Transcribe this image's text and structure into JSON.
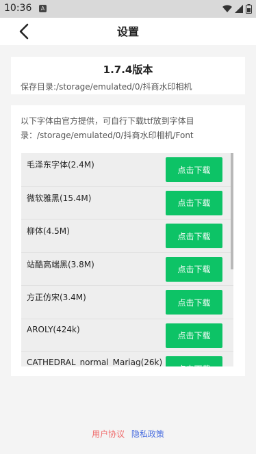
{
  "status": {
    "time": "10:36",
    "notif_label": "A"
  },
  "header": {
    "title": "设置"
  },
  "version_card": {
    "version": "1.7.4版本",
    "save_path": "保存目录:/storage/emulated/0/抖商水印相机"
  },
  "fonts_card": {
    "description": "以下字体由官方提供，可自行下载ttf放到字体目录：/storage/emulated/0/抖商水印相机/Font",
    "items": [
      {
        "name": "毛泽东字体(2.4M)",
        "button": "点击下载"
      },
      {
        "name": "微软雅黑(15.4M)",
        "button": "点击下载"
      },
      {
        "name": "柳体(4.5M)",
        "button": "点击下载"
      },
      {
        "name": "站酷高端黑(3.8M)",
        "button": "点击下载"
      },
      {
        "name": "方正仿宋(3.4M)",
        "button": "点击下载"
      },
      {
        "name": "AROLY(424k)",
        "button": "点击下载"
      },
      {
        "name": "CATHEDRAL_normal_Mariag(26k)",
        "button": "点击下载"
      }
    ]
  },
  "footer": {
    "user_agreement": "用户协议",
    "privacy_policy": "隐私政策"
  },
  "colors": {
    "accent_green": "#0dc366",
    "agreement_red": "#f06b6b",
    "privacy_blue": "#4a6ee0"
  }
}
